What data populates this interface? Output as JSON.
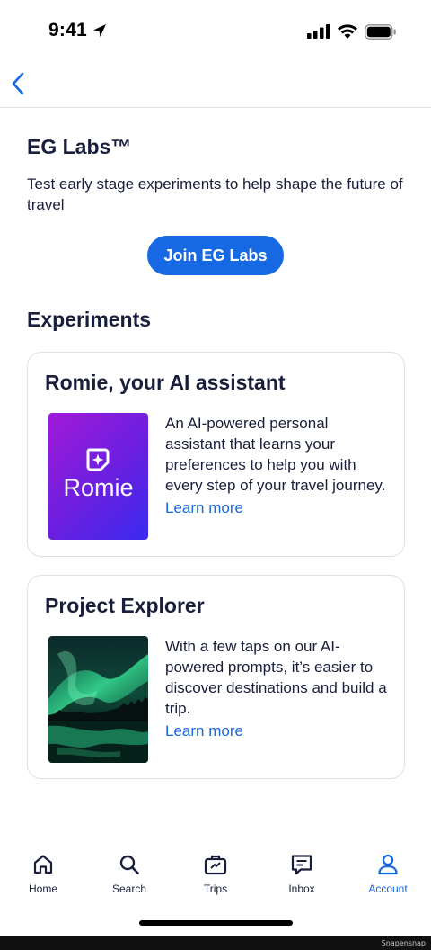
{
  "status_bar": {
    "time": "9:41"
  },
  "page": {
    "title": "EG Labs™",
    "description": "Test early stage experiments to help shape the future of travel",
    "join_button": "Join EG Labs"
  },
  "experiments": {
    "section_title": "Experiments",
    "items": [
      {
        "title": "Romie, your AI assistant",
        "thumb_text": "Romie",
        "description": "An AI-powered personal assistant that learns your preferences to help you with every step of your travel journey.",
        "link": "Learn more"
      },
      {
        "title": "Project Explorer",
        "description": "With a few taps on our AI-powered prompts, it’s easier to discover destinations and build a trip.",
        "link": "Learn more"
      }
    ]
  },
  "tab_bar": {
    "items": [
      {
        "label": "Home",
        "icon": "home-icon"
      },
      {
        "label": "Search",
        "icon": "search-icon"
      },
      {
        "label": "Trips",
        "icon": "suitcase-icon"
      },
      {
        "label": "Inbox",
        "icon": "message-icon"
      },
      {
        "label": "Account",
        "icon": "person-icon"
      }
    ],
    "active": "Account"
  },
  "watermark": "Snapensnap",
  "colors": {
    "accent": "#1668e3",
    "text": "#191e3b",
    "border": "#dfe0e4"
  }
}
